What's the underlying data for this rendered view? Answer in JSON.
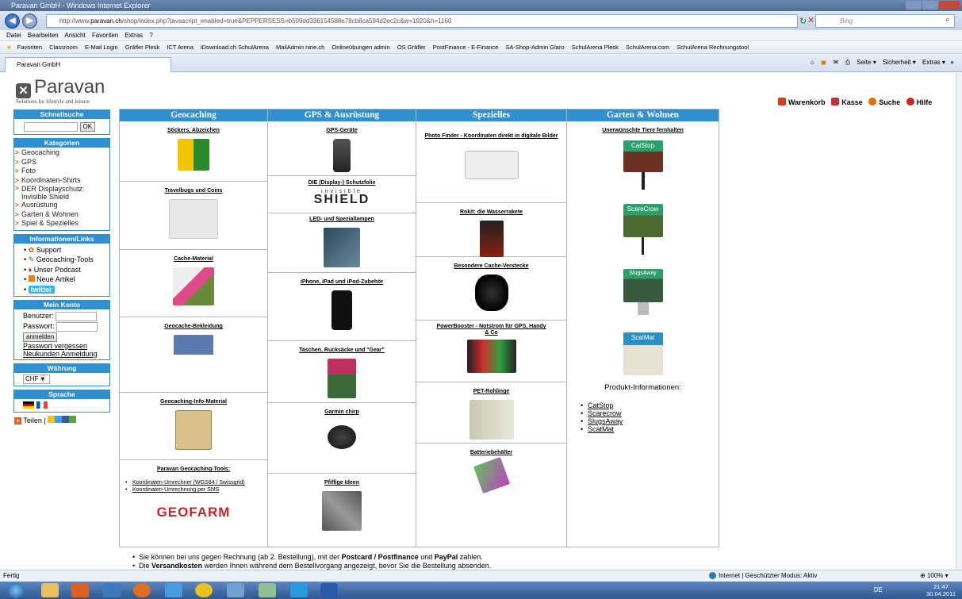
{
  "window": {
    "title": "Paravan GmbH - Windows Internet Explorer"
  },
  "browser": {
    "url_prefix": "http://www.",
    "url_host": "paravan.ch",
    "url_rest": "/shop/index.php?javascript_enabled=true&PEPPERSESS=b509dd336154588e78cb8ca594d2ec2c&w=1920&h=1160",
    "search_placeholder": "Bing",
    "menu": [
      "Datei",
      "Bearbeiten",
      "Ansicht",
      "Favoriten",
      "Extras",
      "?"
    ],
    "favorites_label": "Favoriten",
    "favorites": [
      "Classroom",
      "E-Mail Login",
      "Gräfler Plesk",
      "ICT Arena",
      "iDownload.ch SchulArena",
      "MailAdmin nine.ch",
      "Onlineübungen admin",
      "OS Gräfler",
      "PostFinance - E-Finance",
      "SA-Shop-Admin Glaro",
      "SchulArena Plesk",
      "SchulArena.com",
      "SchulArena Rechnungstool"
    ],
    "tab_label": "Paravan GmbH",
    "commands": [
      "Seite ▾",
      "Sicherheit ▾",
      "Extras ▾"
    ],
    "status_left": "Fertig",
    "status_zone": "Internet | Geschützter Modus: Aktiv",
    "zoom": "100%",
    "lang": "DE",
    "clock_time": "21:47",
    "clock_date": "30.04.2011"
  },
  "site": {
    "logo_text": "Paravan",
    "tagline": "Solutions for lifestyle and leisure",
    "toplinks": [
      {
        "label": "Warenkorb",
        "color": "#d04020"
      },
      {
        "label": "Kasse",
        "color": "#c0303a"
      },
      {
        "label": "Suche",
        "color": "#e07000"
      },
      {
        "label": "Hilfe",
        "color": "#d02020"
      }
    ]
  },
  "sidebar": {
    "quicksearch_title": "Schnellsuche",
    "ok_label": "OK",
    "categories_title": "Kategorien",
    "categories": [
      "Geocaching",
      "GPS",
      "Foto",
      "Koordinaten-Shirts",
      "DER Displayschutz: Invisible Shield",
      "Ausrüstung",
      "Garten & Wohnen",
      "Spiel & Speziell­es"
    ],
    "info_title": "Informationen/Links",
    "info_links": [
      "Support",
      "Geocaching-Tools",
      "Unser Podcast",
      "Neue Artikel"
    ],
    "twitter_label": "twitter",
    "account_title": "Mein Konto",
    "user_label": "Benutzer:",
    "pass_label": "Passwort:",
    "login_label": "anmelden",
    "forgot_label": "Passwort vergessen",
    "register_label": "Neukunden Anmeldung",
    "currency_title": "Währung",
    "currency_value": "CHF",
    "language_title": "Sprache",
    "share_label": "Teilen"
  },
  "columns": [
    {
      "title": "Geocaching",
      "items": [
        "Stickers, Abzeichen",
        "Travelbugs und Coins",
        "Cache-Material",
        "Geocache-Bekleidung",
        "Geocaching-Info-Material",
        "Paravan Geocaching-Tools:"
      ],
      "tools": [
        "Koordinaten-Umrechner (WGS84 / Swissgrid)",
        "Koordinaten-Umrechnung per SMS"
      ],
      "geofarm": "GEOFARM"
    },
    {
      "title": "GPS & Ausrüstung",
      "items": [
        "GPS-Geräte",
        "DIE (Display-) Schutzfolie",
        "LED- und Speziallampen",
        "iPhone, iPad und iPod-Zubehör",
        "Taschen, Rucksäcke und \"Gear\"",
        "Garmin chirp",
        "Pfiffige Ideen"
      ],
      "shield_small": "invisible",
      "shield_big": "SHIELD"
    },
    {
      "title": "Speziell­es",
      "items": [
        "Photo Finder - Koordinaten direkt in digitale Bilder",
        "Rokit: die Wasserrakete",
        "Besondere Cache-Verstecke",
        "PowerBooster - Notstrom für GPS, Handy & Co",
        "PET-Rohlinge",
        "Batteriebehälter"
      ]
    },
    {
      "title": "Garten & Wohnen",
      "items": [
        "Unerwünschte Tiere fernhalten"
      ],
      "products": [
        "CatStop",
        "ScareCrow",
        "SlugsAway",
        "ScatMat"
      ],
      "prodinfo": "Produkt-Informationen:",
      "prodlinks": [
        "CatStop",
        "Scarecrow",
        "SlugsAway",
        "ScatMat"
      ]
    }
  ],
  "notes": {
    "line1_a": "Sie können bei uns gegen Rechnung (ab 2. Bestellung), mit der ",
    "line1_b": "Postcard / Postfinance",
    "line1_c": " und ",
    "line1_d": "PayPal",
    "line1_e": " zahlen.",
    "line2_a": "Die ",
    "line2_b": "Versandkosten",
    "line2_c": " werden Ihnen während dem Bestellvorgang angezeigt, bevor Sie die Bestellung absenden."
  }
}
